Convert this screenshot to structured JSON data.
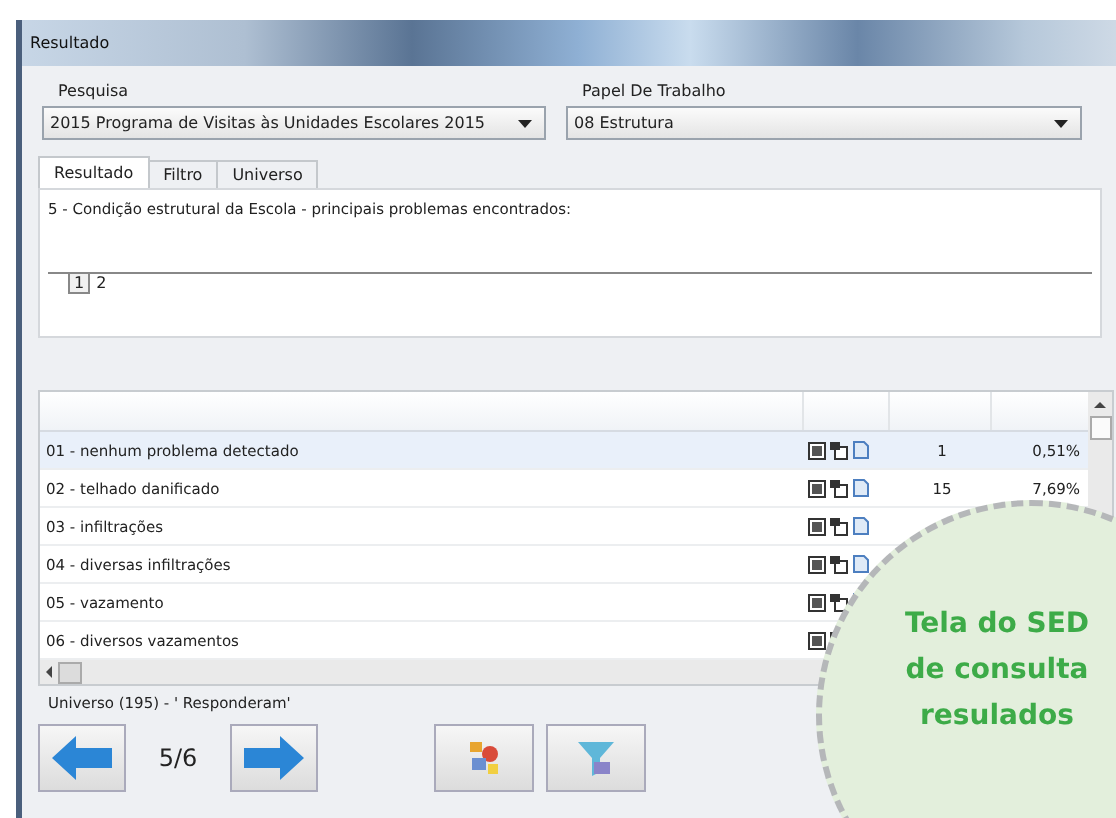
{
  "window": {
    "title": "Resultado"
  },
  "filters": [
    {
      "label": "Pesquisa",
      "value": "2015 Programa de Visitas às Unidades Escolares 2015"
    },
    {
      "label": "Papel De Trabalho",
      "value": "08 Estrutura"
    }
  ],
  "tabs": [
    {
      "label": "Resultado",
      "selected": true
    },
    {
      "label": "Filtro",
      "selected": false
    },
    {
      "label": "Universo",
      "selected": false
    }
  ],
  "question": "5 - Condição estrutural da Escola - principais problemas encontrados:",
  "pages": [
    {
      "label": "1",
      "selected": true
    },
    {
      "label": "2",
      "selected": false
    }
  ],
  "rows": [
    {
      "label": "01 - nenhum problema detectado",
      "count": "1",
      "percent": "0,51%",
      "selected": true
    },
    {
      "label": "02 - telhado danificado",
      "count": "15",
      "percent": "7,69%",
      "selected": false
    },
    {
      "label": "03 - infiltrações",
      "selected": false
    },
    {
      "label": "04 - diversas infiltrações",
      "selected": false
    },
    {
      "label": "05 - vazamento",
      "selected": false
    },
    {
      "label": "06 - diversos vazamentos",
      "selected": false
    }
  ],
  "status": "Universo (195) - ' Responderam'",
  "pager": "5/6",
  "callout": [
    "Tela do SED",
    "de consulta",
    "resulados"
  ]
}
